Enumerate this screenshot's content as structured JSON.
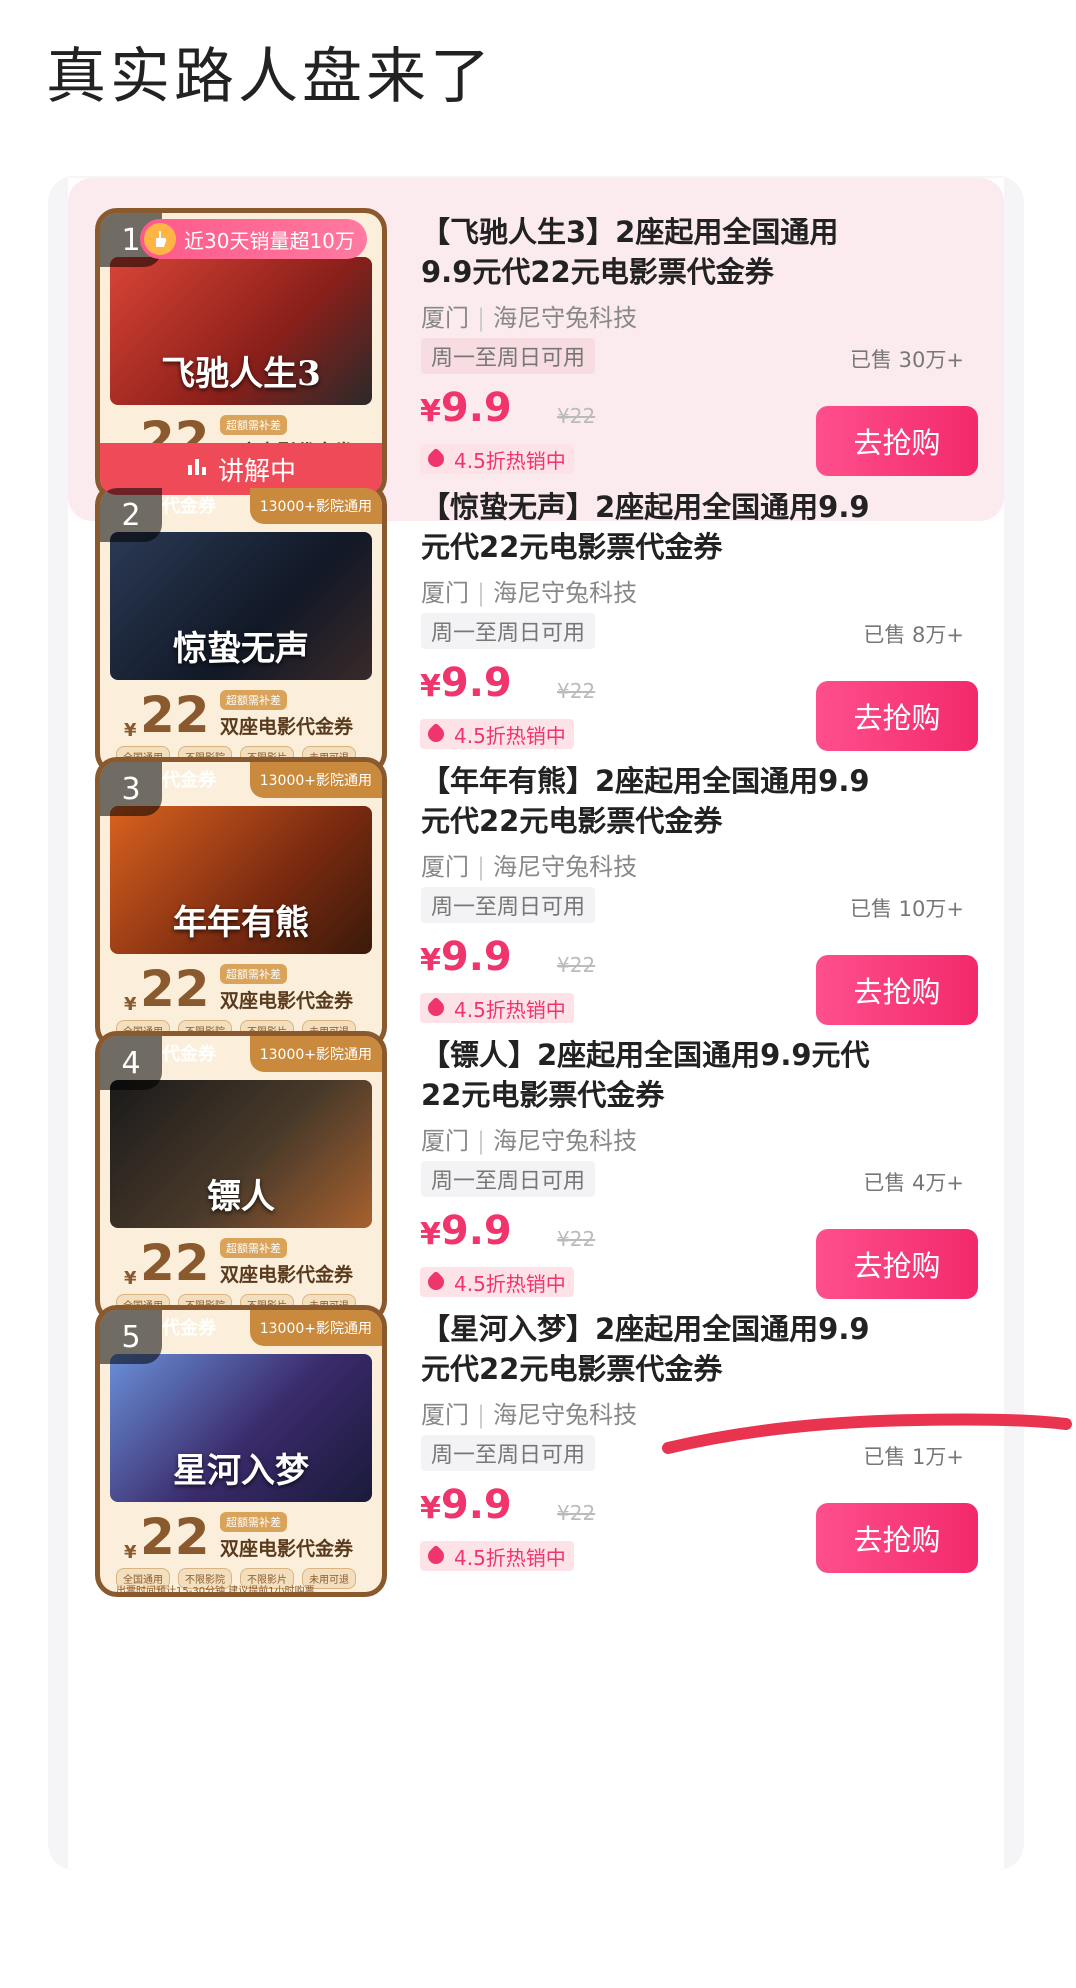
{
  "headline": "真实路人盘来了",
  "colors": {
    "accent": "#f0356c",
    "button_gradient": [
      "#ff4f8d",
      "#f2296b"
    ],
    "live_bar": "#ef4a58",
    "annotation": "#e8344f"
  },
  "common": {
    "merchant_city": "厦门",
    "merchant_separator": "|",
    "merchant_name": "海尼守兔科技",
    "availability": "周一至周日可用",
    "price_symbol": "¥",
    "price": "9.9",
    "original_price": "¥22",
    "discount_label": "4.5折热销中",
    "buy_label": "去抢购",
    "thumb_coupon_tag": "代金券",
    "thumb_cinemas_tag": "13000+影院通用",
    "thumb_yen": "¥",
    "thumb_price": "22",
    "thumb_subsidy": "超额需补差",
    "thumb_desc": "双座电影代金券",
    "thumb_chips": [
      "全国通用",
      "不限影院",
      "不限影片",
      "未用可退"
    ],
    "thumb_note": "出票时间预计15-30分钟 建议提前1小时购票"
  },
  "products": [
    {
      "rank": "1",
      "title": "【飞驰人生3】2座起用全国通用9.9元代22元电影票代金券",
      "poster_title": "飞驰人生3",
      "sold": "已售 30万+",
      "live": true,
      "live_label": "讲解中",
      "sales_badge": "近30天销量超10万"
    },
    {
      "rank": "2",
      "title": "【惊蛰无声】2座起用全国通用9.9元代22元电影票代金券",
      "poster_title": "惊蛰无声",
      "sold": "已售 8万+",
      "live": false
    },
    {
      "rank": "3",
      "title": "【年年有熊】2座起用全国通用9.9元代22元电影票代金券",
      "poster_title": "年年有熊",
      "sold": "已售 10万+",
      "live": false
    },
    {
      "rank": "4",
      "title": "【镖人】2座起用全国通用9.9元代22元电影票代金券",
      "poster_title": "镖人",
      "sold": "已售 4万+",
      "live": false
    },
    {
      "rank": "5",
      "title": "【星河入梦】2座起用全国通用9.9元代22元电影票代金券",
      "poster_title": "星河入梦",
      "sold": "已售 1万+",
      "live": false
    }
  ]
}
